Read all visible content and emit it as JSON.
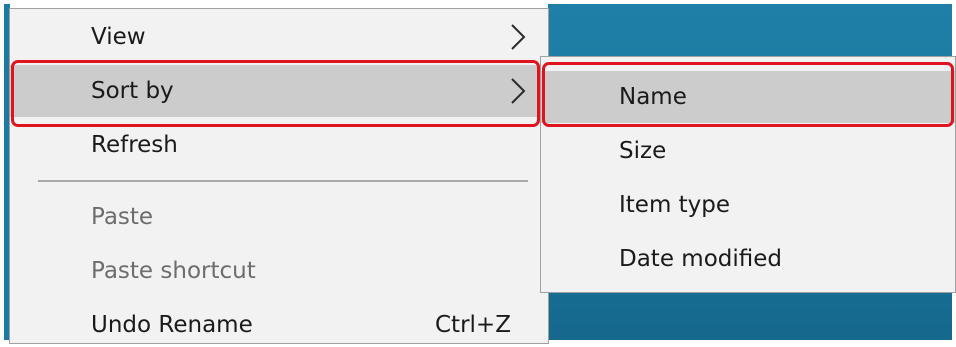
{
  "menu": {
    "items": [
      {
        "label": "View",
        "submenu_arrow": "chevron-right-icon"
      },
      {
        "label": "Sort by",
        "submenu_arrow": "chevron-right-icon",
        "state": "hovered"
      },
      {
        "label": "Refresh"
      },
      {
        "label": "Paste",
        "state": "disabled"
      },
      {
        "label": "Paste shortcut",
        "state": "disabled"
      },
      {
        "label": "Undo Rename",
        "shortcut": "Ctrl+Z"
      }
    ]
  },
  "sort_submenu": {
    "items": [
      {
        "label": "Name",
        "state": "hovered"
      },
      {
        "label": "Size"
      },
      {
        "label": "Item type"
      },
      {
        "label": "Date modified"
      }
    ]
  },
  "colors": {
    "menu_background": "#f2f2f2",
    "hover_background": "#cccccc",
    "highlight_outline": "#e0141e",
    "desktop_background": "#1b7aa1",
    "disabled_text": "#6d6d6d"
  }
}
